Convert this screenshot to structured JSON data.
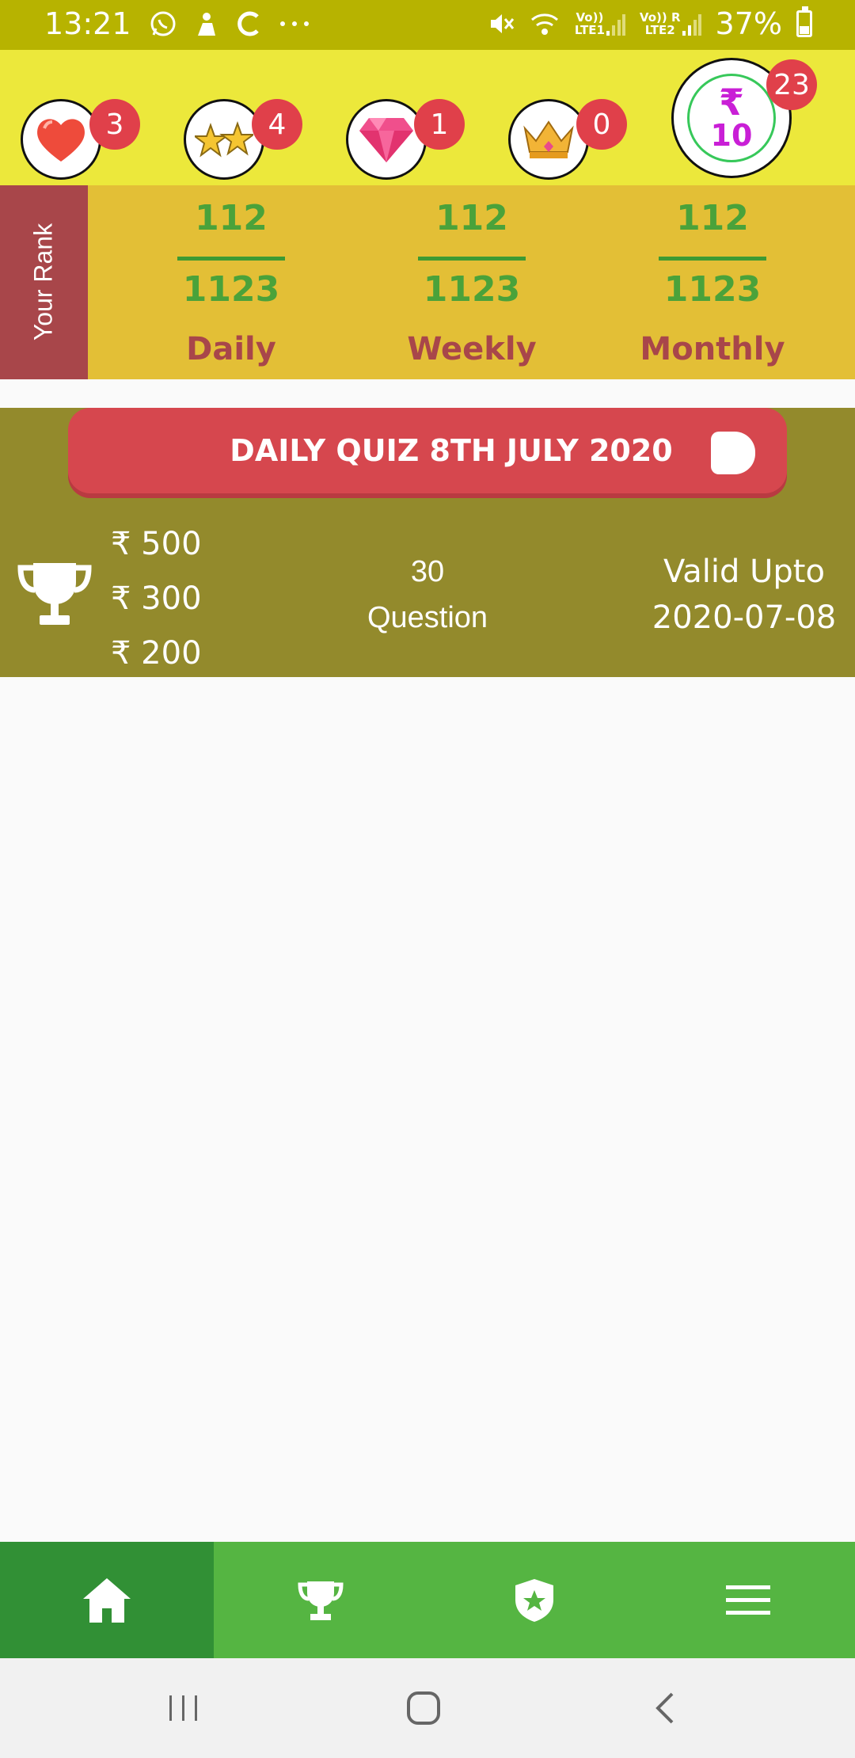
{
  "status_bar": {
    "time": "13:21",
    "left_icons": [
      "whatsapp-icon",
      "app-notification-icon",
      "c-icon",
      "more-icon"
    ],
    "sim1_label": "LTE1",
    "sim2_label": "LTE2",
    "volte": "Vo))",
    "roaming": "R",
    "battery": "37%"
  },
  "header": {
    "items": [
      {
        "icon": "heart-icon",
        "count": "3"
      },
      {
        "icon": "stars-icon",
        "count": "4"
      },
      {
        "icon": "diamond-icon",
        "count": "1"
      },
      {
        "icon": "crown-icon",
        "count": "0"
      }
    ],
    "coin": {
      "symbol": "₹",
      "value": "10",
      "count": "23"
    }
  },
  "rank": {
    "label": "Your Rank",
    "columns": [
      {
        "rank": "112",
        "total": "1123",
        "period": "Daily"
      },
      {
        "rank": "112",
        "total": "1123",
        "period": "Weekly"
      },
      {
        "rank": "112",
        "total": "1123",
        "period": "Monthly"
      }
    ]
  },
  "quiz": {
    "title": "DAILY QUIZ 8TH JULY 2020",
    "prizes": [
      "₹ 500",
      "₹ 300",
      "₹ 200"
    ],
    "question_count": "30",
    "question_label": "Question",
    "valid_label": "Valid Upto",
    "valid_date": "2020-07-08"
  },
  "bottom_nav": [
    "home-icon",
    "trophy-icon",
    "badge-star-icon",
    "menu-icon"
  ],
  "colors": {
    "status_bar": "#b7b300",
    "header": "#ece83b",
    "rank_panel": "#e3bf36",
    "rank_tab": "#a8464a",
    "rank_number": "#4aa23a",
    "quiz_card": "#938a2c",
    "quiz_button": "#d6474e",
    "nav": "#55b542",
    "nav_active": "#319035"
  }
}
